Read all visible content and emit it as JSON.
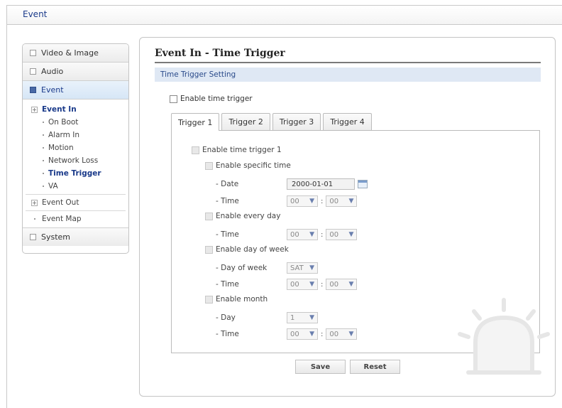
{
  "header": {
    "title": "Event"
  },
  "sidebar": {
    "video_image": "Video & Image",
    "audio": "Audio",
    "event": "Event",
    "event_in": "Event In",
    "items": [
      "On Boot",
      "Alarm In",
      "Motion",
      "Network Loss",
      "Time Trigger",
      "VA"
    ],
    "event_out": "Event Out",
    "event_map": "Event Map",
    "system": "System"
  },
  "main": {
    "title": "Event In - Time Trigger",
    "section": "Time Trigger Setting",
    "enable_label": "Enable time trigger",
    "tabs": [
      "Trigger 1",
      "Trigger 2",
      "Trigger 3",
      "Trigger 4"
    ],
    "form": {
      "enable_trigger": "Enable time trigger 1",
      "specific_time": "Enable specific time",
      "date_label": "- Date",
      "date_value": "2000-01-01",
      "time_label": "- Time",
      "every_day": "Enable every day",
      "day_of_week": "Enable day of week",
      "dow_label": "- Day of week",
      "dow_value": "SAT",
      "month": "Enable month",
      "day_label": "- Day",
      "day_value": "1",
      "hour": "00",
      "minute": "00"
    },
    "save": "Save",
    "reset": "Reset"
  },
  "colors": {
    "accent": "#1a3a8a",
    "section_bg": "#dfe8f4"
  }
}
